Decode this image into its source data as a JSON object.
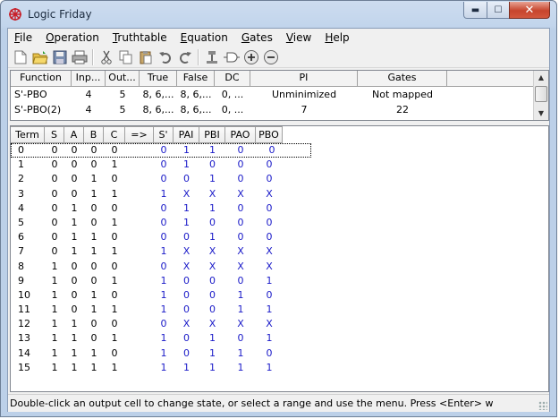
{
  "window": {
    "title": "Logic Friday"
  },
  "menu": [
    {
      "label": "File",
      "u": "F",
      "rest": "ile"
    },
    {
      "label": "Operation",
      "u": "O",
      "rest": "peration"
    },
    {
      "label": "Truthtable",
      "u": "T",
      "rest": "ruthtable"
    },
    {
      "label": "Equation",
      "u": "E",
      "rest": "quation"
    },
    {
      "label": "Gates",
      "u": "G",
      "rest": "ates"
    },
    {
      "label": "View",
      "u": "V",
      "rest": "iew"
    },
    {
      "label": "Help",
      "u": "H",
      "rest": "elp"
    }
  ],
  "toolbar": [
    "new-file-icon",
    "open-folder-icon",
    "save-icon",
    "print-icon",
    "cut-icon",
    "copy-icon",
    "paste-icon",
    "undo-icon",
    "redo-icon",
    "pin-tool-icon",
    "gate-tool-icon",
    "zoom-in-icon",
    "zoom-out-icon"
  ],
  "functions_table": {
    "headers": [
      "Function",
      "Inp...",
      "Out...",
      "True",
      "False",
      "DC",
      "PI",
      "Gates"
    ],
    "rows": [
      [
        "S'-PBO",
        "4",
        "5",
        "8, 6,...",
        "8, 6,...",
        "0, ...",
        "Unminimized",
        "Not mapped"
      ],
      [
        "S'-PBO(2)",
        "4",
        "5",
        "8, 6,...",
        "8, 6,...",
        "0, ...",
        "7",
        "22"
      ]
    ]
  },
  "truth_table": {
    "headers": [
      "Term",
      "S",
      "A",
      "B",
      "C",
      "=>",
      "S'",
      "PAI",
      "PBI",
      "PAO",
      "PBO"
    ],
    "rows": [
      [
        "0",
        "0",
        "0",
        "0",
        "0",
        "",
        "0",
        "1",
        "1",
        "0",
        "0"
      ],
      [
        "1",
        "0",
        "0",
        "0",
        "1",
        "",
        "0",
        "1",
        "0",
        "0",
        "0"
      ],
      [
        "2",
        "0",
        "0",
        "1",
        "0",
        "",
        "0",
        "0",
        "1",
        "0",
        "0"
      ],
      [
        "3",
        "0",
        "0",
        "1",
        "1",
        "",
        "1",
        "X",
        "X",
        "X",
        "X"
      ],
      [
        "4",
        "0",
        "1",
        "0",
        "0",
        "",
        "0",
        "1",
        "1",
        "0",
        "0"
      ],
      [
        "5",
        "0",
        "1",
        "0",
        "1",
        "",
        "0",
        "1",
        "0",
        "0",
        "0"
      ],
      [
        "6",
        "0",
        "1",
        "1",
        "0",
        "",
        "0",
        "0",
        "1",
        "0",
        "0"
      ],
      [
        "7",
        "0",
        "1",
        "1",
        "1",
        "",
        "1",
        "X",
        "X",
        "X",
        "X"
      ],
      [
        "8",
        "1",
        "0",
        "0",
        "0",
        "",
        "0",
        "X",
        "X",
        "X",
        "X"
      ],
      [
        "9",
        "1",
        "0",
        "0",
        "1",
        "",
        "1",
        "0",
        "0",
        "0",
        "1"
      ],
      [
        "10",
        "1",
        "0",
        "1",
        "0",
        "",
        "1",
        "0",
        "0",
        "1",
        "0"
      ],
      [
        "11",
        "1",
        "0",
        "1",
        "1",
        "",
        "1",
        "0",
        "0",
        "1",
        "1"
      ],
      [
        "12",
        "1",
        "1",
        "0",
        "0",
        "",
        "0",
        "X",
        "X",
        "X",
        "X"
      ],
      [
        "13",
        "1",
        "1",
        "0",
        "1",
        "",
        "1",
        "0",
        "1",
        "0",
        "1"
      ],
      [
        "14",
        "1",
        "1",
        "1",
        "0",
        "",
        "1",
        "0",
        "1",
        "1",
        "0"
      ],
      [
        "15",
        "1",
        "1",
        "1",
        "1",
        "",
        "1",
        "1",
        "1",
        "1",
        "1"
      ]
    ]
  },
  "status": {
    "text": "Double-click an output cell to change state, or select a range and use the menu. Press <Enter> w"
  }
}
